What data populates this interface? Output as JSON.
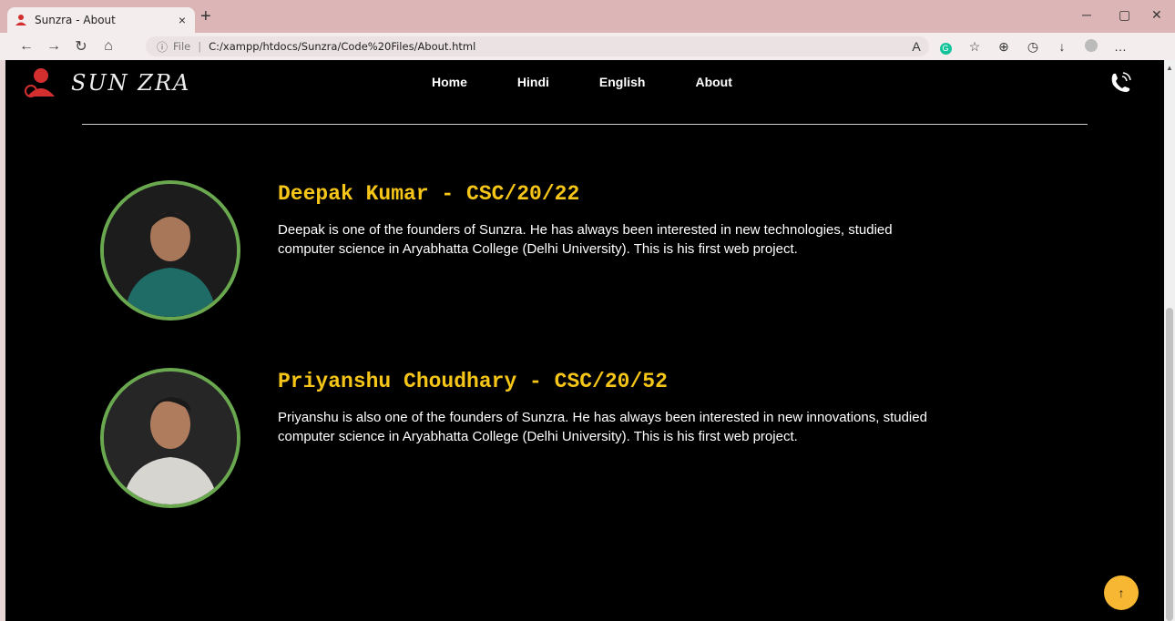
{
  "browser": {
    "tab_title": "Sunzra - About",
    "tab_close": "×",
    "new_tab": "+",
    "url_info": "ⓘ",
    "url_scheme": "File",
    "url_sep": "|",
    "url_path": "C:/xampp/htdocs/Sunzra/Code%20Files/About.html"
  },
  "site": {
    "logo_text": "SUN ZRA",
    "menu": [
      "Home",
      "Hindi",
      "English",
      "About"
    ]
  },
  "members": [
    {
      "name": "Deepak Kumar - CSC/20/22",
      "description": "Deepak is one of the founders of Sunzra. He has always been interested in new technologies, studied computer science in Aryabhatta College (Delhi University). This is his first web project."
    },
    {
      "name": "Priyanshu Choudhary - CSC/20/52",
      "description": "Priyanshu is also one of the founders of Sunzra. He has always been interested in new innovations, studied computer science in Aryabhatta College (Delhi University). This is his first web project."
    }
  ],
  "colors": {
    "accent": "#f5c518",
    "avatar_border": "#6aa84f",
    "page_bg": "#000000",
    "to_top": "#f7b733"
  },
  "to_top_label": "↑"
}
